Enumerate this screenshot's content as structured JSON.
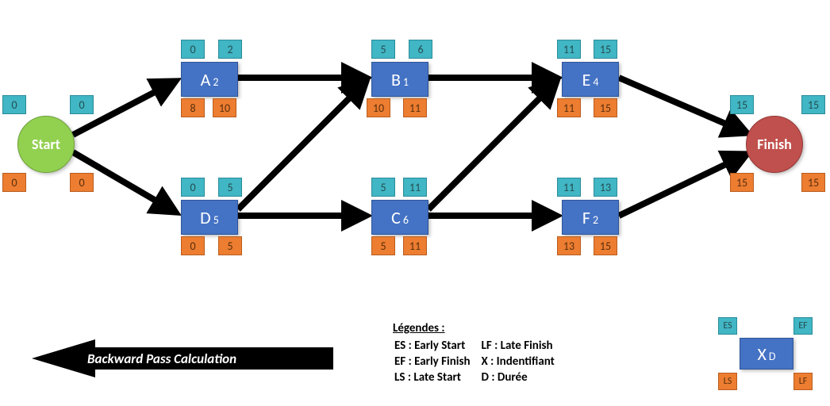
{
  "chart_data": {
    "type": "network-diagram",
    "title": "Backward Pass Calculation",
    "start": {
      "label": "Start",
      "ES": 0,
      "EF": 0,
      "LS": 0,
      "LF": 0
    },
    "finish": {
      "label": "Finish",
      "ES": 15,
      "EF": 15,
      "LS": 15,
      "LF": 15
    },
    "activities": {
      "A": {
        "id": "A",
        "duration": 2,
        "ES": 0,
        "EF": 2,
        "LS": 8,
        "LF": 10
      },
      "B": {
        "id": "B",
        "duration": 1,
        "ES": 5,
        "EF": 6,
        "LS": 10,
        "LF": 11
      },
      "C": {
        "id": "C",
        "duration": 6,
        "ES": 5,
        "EF": 11,
        "LS": 5,
        "LF": 11
      },
      "D": {
        "id": "D",
        "duration": 5,
        "ES": 0,
        "EF": 5,
        "LS": 0,
        "LF": 5
      },
      "E": {
        "id": "E",
        "duration": 4,
        "ES": 11,
        "EF": 15,
        "LS": 11,
        "LF": 15
      },
      "F": {
        "id": "F",
        "duration": 2,
        "ES": 11,
        "EF": 13,
        "LS": 13,
        "LF": 15
      }
    },
    "edges": [
      [
        "Start",
        "A"
      ],
      [
        "Start",
        "D"
      ],
      [
        "A",
        "B"
      ],
      [
        "D",
        "B"
      ],
      [
        "D",
        "C"
      ],
      [
        "B",
        "E"
      ],
      [
        "C",
        "E"
      ],
      [
        "C",
        "F"
      ],
      [
        "E",
        "Finish"
      ],
      [
        "F",
        "Finish"
      ]
    ]
  },
  "legend": {
    "title": "Légendes :",
    "es": "ES : Early Start",
    "ef": "EF : Early Finish",
    "ls": "LS : Late Start",
    "lf": "LF : Late Finish",
    "x": "X : Indentifiant",
    "d": "D : Durée",
    "mini": {
      "id": "X",
      "dur": "D",
      "es": "ES",
      "ef": "EF",
      "ls": "LS",
      "lf": "LF"
    }
  },
  "direction_label": "Backward Pass Calculation"
}
